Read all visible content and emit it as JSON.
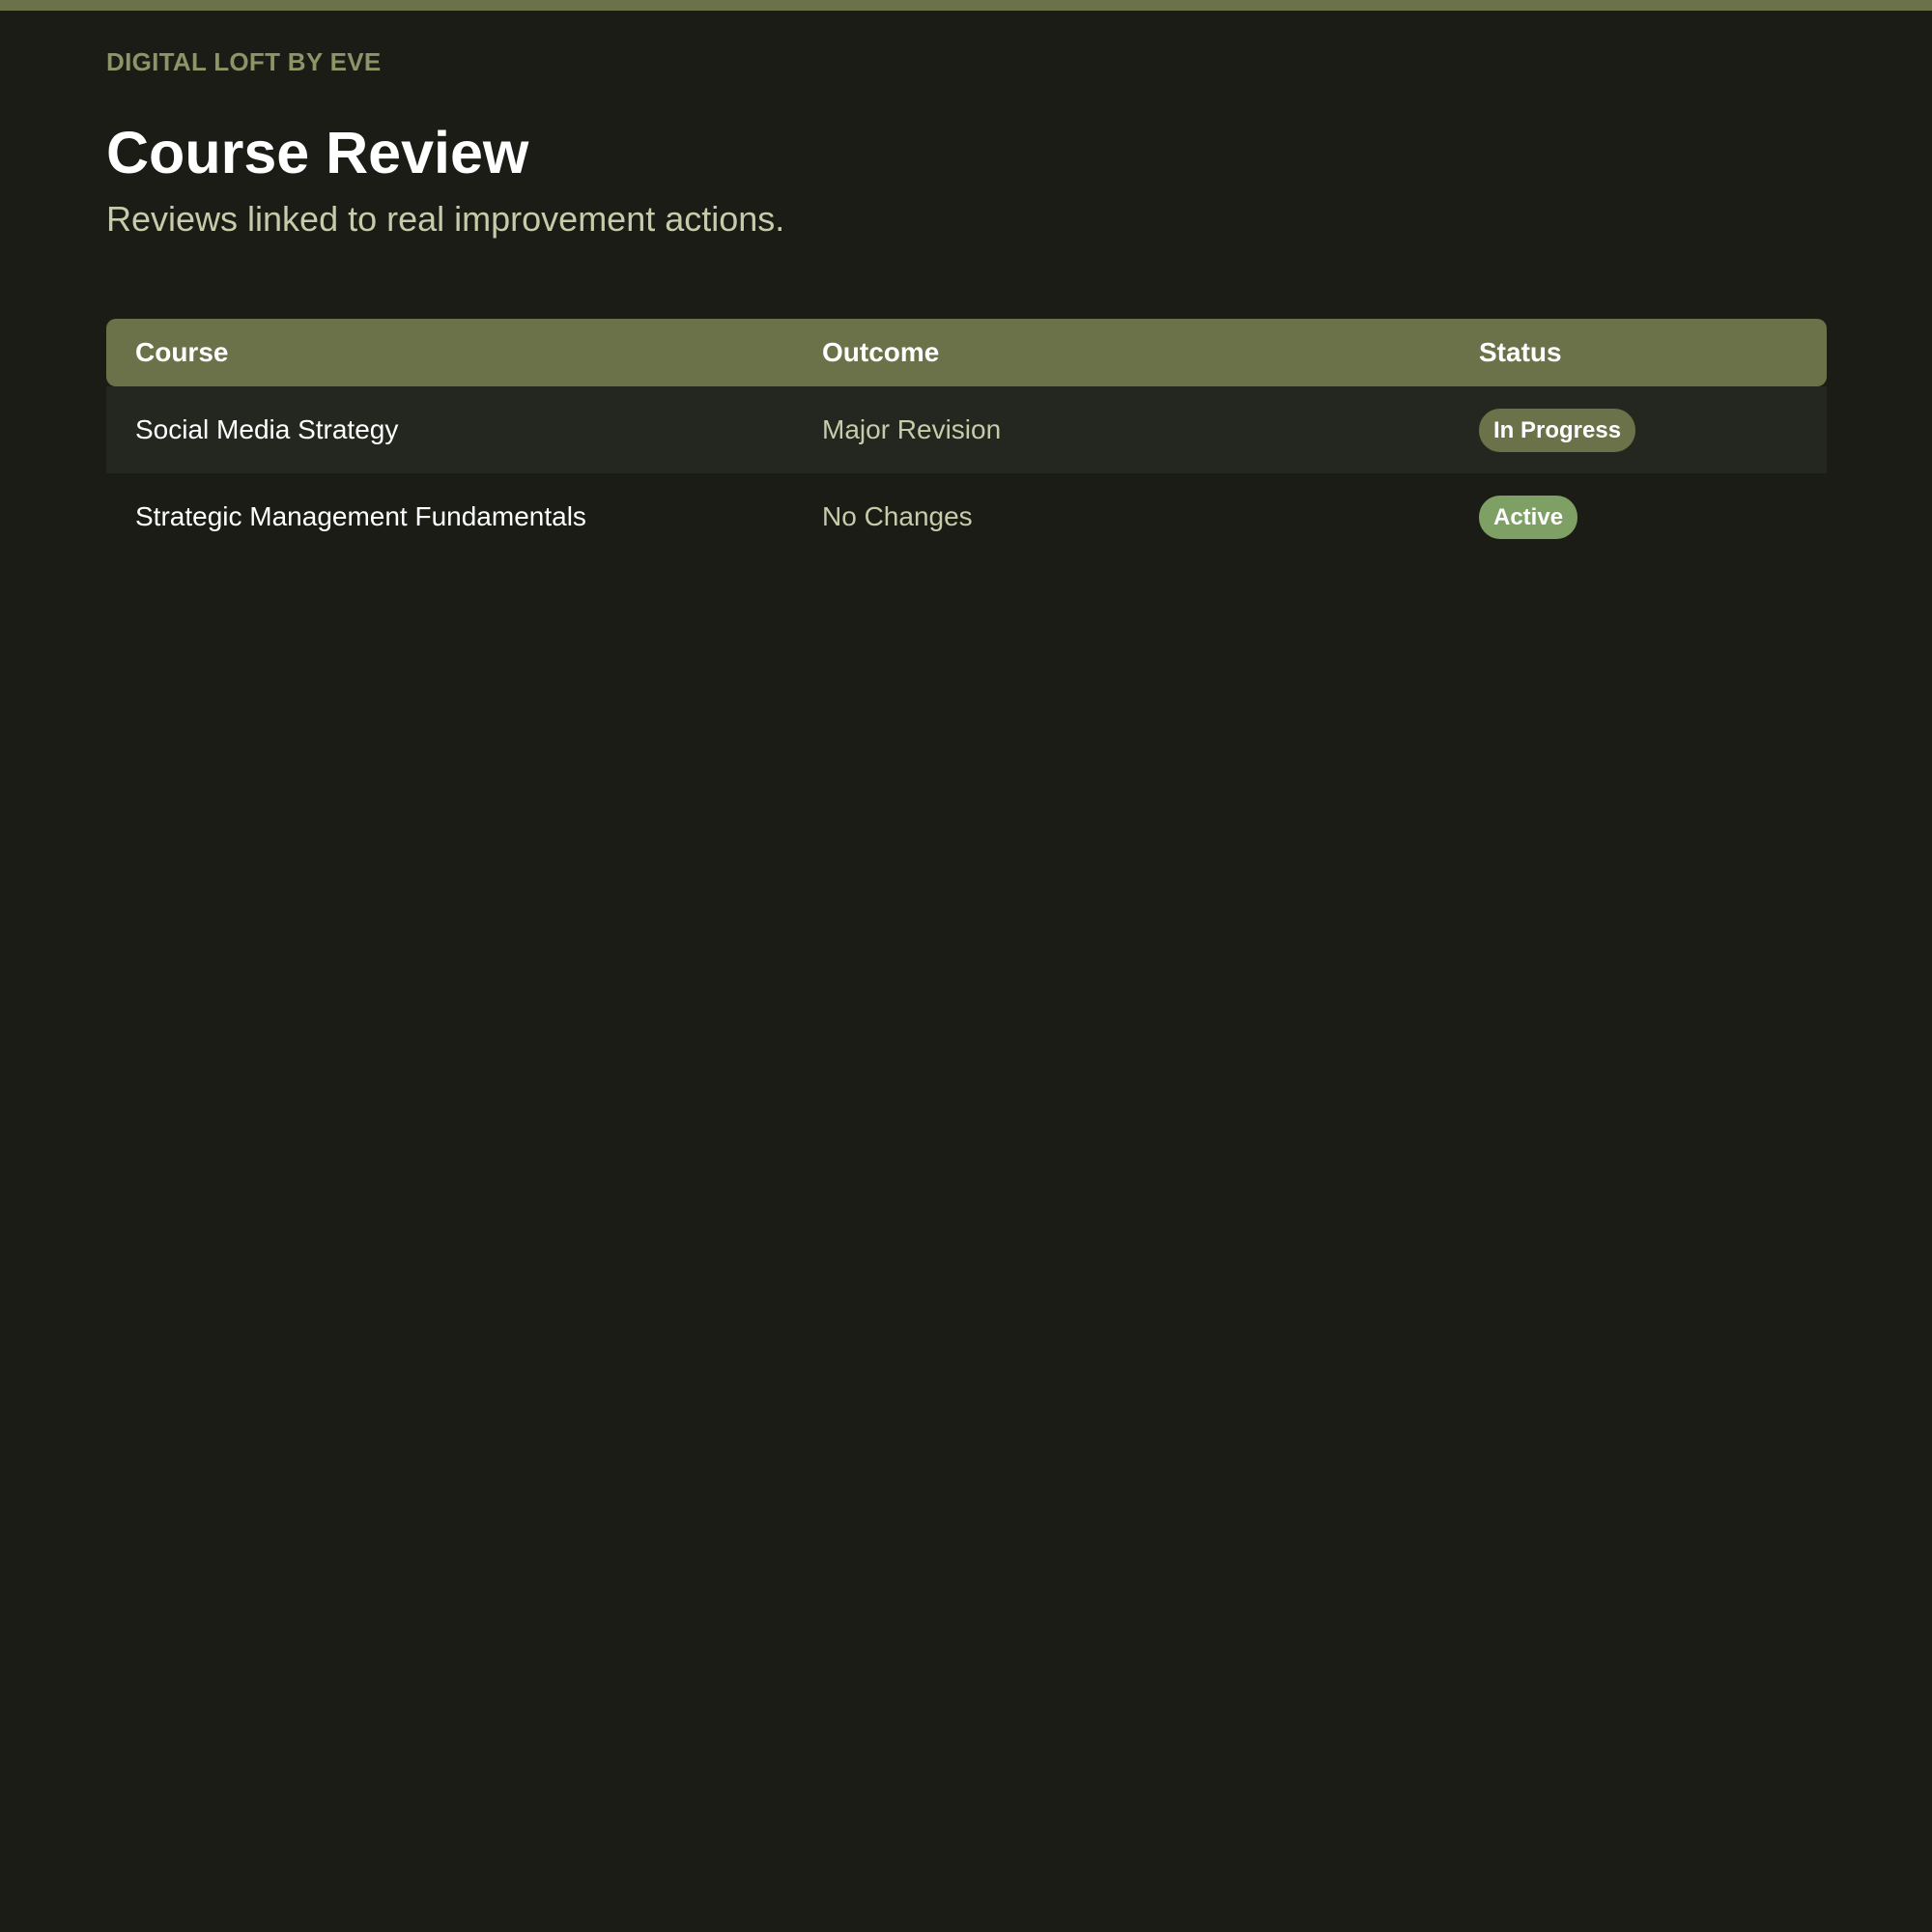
{
  "brand": "DIGITAL LOFT BY EVE",
  "header": {
    "title": "Course Review",
    "subtitle": "Reviews linked to real improvement actions."
  },
  "table": {
    "columns": [
      "Course",
      "Outcome",
      "Status"
    ],
    "rows": [
      {
        "course": "Social Media Strategy",
        "outcome": "Major Revision",
        "status": "In Progress",
        "status_color": "#6b7249"
      },
      {
        "course": "Strategic Management Fundamentals",
        "outcome": "No Changes",
        "status": "Active",
        "status_color": "#7fa065"
      }
    ]
  },
  "colors": {
    "background": "#1a1c15",
    "accent": "#6b7249",
    "brand_text": "#8e9468",
    "muted_text": "#c7cbaa"
  }
}
